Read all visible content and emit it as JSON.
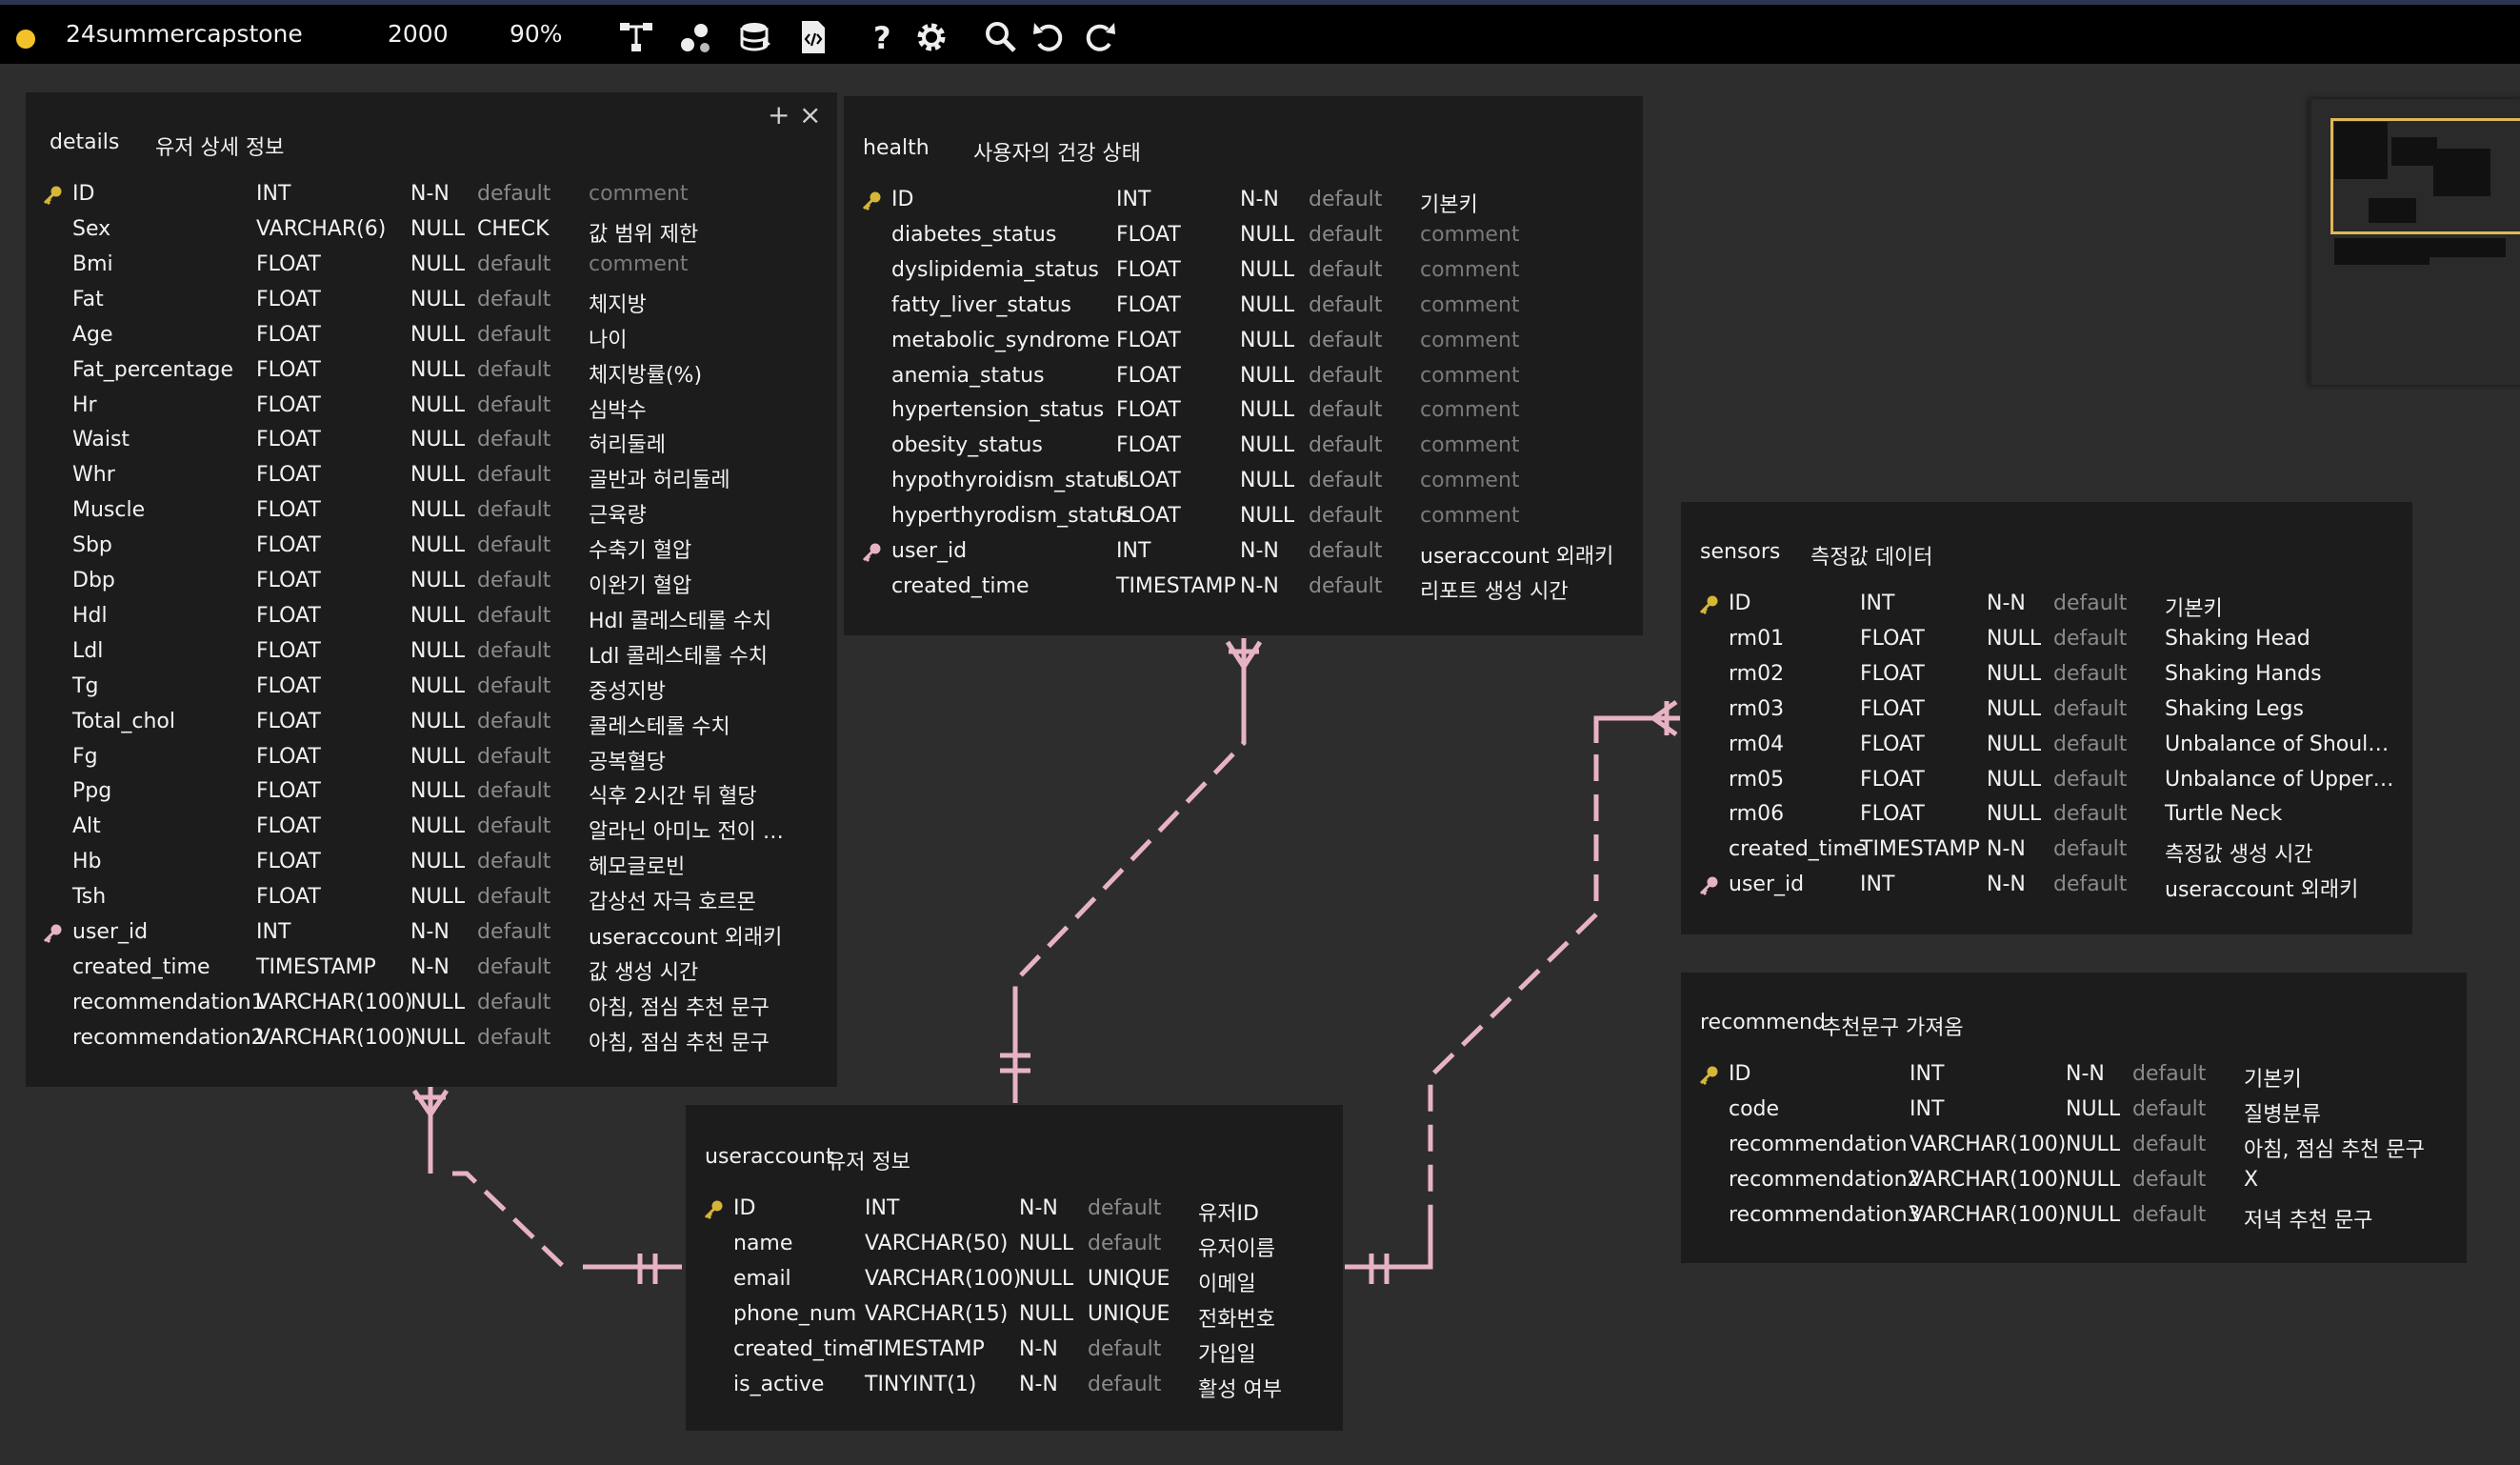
{
  "toolbar": {
    "project_name": "24summercapstone",
    "canvas_size": "2000",
    "zoom": "90%",
    "icons": [
      "diagram-icon",
      "relation-icon",
      "database-icon",
      "code-file-icon",
      "help-icon",
      "settings-icon",
      "search-icon",
      "undo-icon",
      "redo-icon"
    ]
  },
  "colors": {
    "background": "#2d2d2d",
    "table_background": "#1c1c1c",
    "relation_line": "#e7b3c3",
    "key": "#d6b637",
    "minimap_viewport": "#e0b85a",
    "status_dot": "#f3c12a"
  },
  "tables": {
    "details": {
      "name": "details",
      "comment": "유저 상세 정보",
      "header": {
        "name": "ID",
        "type": "INT",
        "nn": "N-N",
        "def": "default",
        "comment": "comment"
      },
      "columns": [
        {
          "name": "Sex",
          "type": "VARCHAR(6)",
          "nn": "NULL",
          "def": "CHECK",
          "comment": "값 범위 제한"
        },
        {
          "name": "Bmi",
          "type": "FLOAT",
          "nn": "NULL",
          "def": "default",
          "comment": "comment"
        },
        {
          "name": "Fat",
          "type": "FLOAT",
          "nn": "NULL",
          "def": "default",
          "comment": "체지방"
        },
        {
          "name": "Age",
          "type": "FLOAT",
          "nn": "NULL",
          "def": "default",
          "comment": "나이"
        },
        {
          "name": "Fat_percentage",
          "type": "FLOAT",
          "nn": "NULL",
          "def": "default",
          "comment": "체지방률(%)"
        },
        {
          "name": "Hr",
          "type": "FLOAT",
          "nn": "NULL",
          "def": "default",
          "comment": "심박수"
        },
        {
          "name": "Waist",
          "type": "FLOAT",
          "nn": "NULL",
          "def": "default",
          "comment": "허리둘레"
        },
        {
          "name": "Whr",
          "type": "FLOAT",
          "nn": "NULL",
          "def": "default",
          "comment": "골반과 허리둘레"
        },
        {
          "name": "Muscle",
          "type": "FLOAT",
          "nn": "NULL",
          "def": "default",
          "comment": "근육량"
        },
        {
          "name": "Sbp",
          "type": "FLOAT",
          "nn": "NULL",
          "def": "default",
          "comment": "수축기 혈압"
        },
        {
          "name": "Dbp",
          "type": "FLOAT",
          "nn": "NULL",
          "def": "default",
          "comment": "이완기 혈압"
        },
        {
          "name": "Hdl",
          "type": "FLOAT",
          "nn": "NULL",
          "def": "default",
          "comment": "Hdl 콜레스테롤 수치"
        },
        {
          "name": "Ldl",
          "type": "FLOAT",
          "nn": "NULL",
          "def": "default",
          "comment": "Ldl 콜레스테롤 수치"
        },
        {
          "name": "Tg",
          "type": "FLOAT",
          "nn": "NULL",
          "def": "default",
          "comment": "중성지방"
        },
        {
          "name": "Total_chol",
          "type": "FLOAT",
          "nn": "NULL",
          "def": "default",
          "comment": "콜레스테롤 수치"
        },
        {
          "name": "Fg",
          "type": "FLOAT",
          "nn": "NULL",
          "def": "default",
          "comment": "공복혈당"
        },
        {
          "name": "Ppg",
          "type": "FLOAT",
          "nn": "NULL",
          "def": "default",
          "comment": "식후 2시간 뒤 혈당"
        },
        {
          "name": "Alt",
          "type": "FLOAT",
          "nn": "NULL",
          "def": "default",
          "comment": "알라닌 아미노 전이 …"
        },
        {
          "name": "Hb",
          "type": "FLOAT",
          "nn": "NULL",
          "def": "default",
          "comment": "헤모글로빈"
        },
        {
          "name": "Tsh",
          "type": "FLOAT",
          "nn": "NULL",
          "def": "default",
          "comment": "갑상선 자극 호르몬"
        },
        {
          "name": "user_id",
          "type": "INT",
          "nn": "N-N",
          "def": "default",
          "comment": "useraccount 외래키"
        },
        {
          "name": "created_time",
          "type": "TIMESTAMP",
          "nn": "N-N",
          "def": "default",
          "comment": "값 생성 시간"
        },
        {
          "name": "recommendation1",
          "type": "VARCHAR(100)",
          "nn": "NULL",
          "def": "default",
          "comment": "아침, 점심 추천 문구"
        },
        {
          "name": "recommendation2",
          "type": "VARCHAR(100)",
          "nn": "NULL",
          "def": "default",
          "comment": "아침, 점심 추천 문구"
        }
      ]
    },
    "health": {
      "name": "health",
      "comment": "사용자의 건강 상태",
      "columns": [
        {
          "name": "ID",
          "type": "INT",
          "nn": "N-N",
          "def": "default",
          "comment": "기본키"
        },
        {
          "name": "diabetes_status",
          "type": "FLOAT",
          "nn": "NULL",
          "def": "default",
          "comment": "comment"
        },
        {
          "name": "dyslipidemia_status",
          "type": "FLOAT",
          "nn": "NULL",
          "def": "default",
          "comment": "comment"
        },
        {
          "name": "fatty_liver_status",
          "type": "FLOAT",
          "nn": "NULL",
          "def": "default",
          "comment": "comment"
        },
        {
          "name": "metabolic_syndrome",
          "type": "FLOAT",
          "nn": "NULL",
          "def": "default",
          "comment": "comment"
        },
        {
          "name": "anemia_status",
          "type": "FLOAT",
          "nn": "NULL",
          "def": "default",
          "comment": "comment"
        },
        {
          "name": "hypertension_status",
          "type": "FLOAT",
          "nn": "NULL",
          "def": "default",
          "comment": "comment"
        },
        {
          "name": "obesity_status",
          "type": "FLOAT",
          "nn": "NULL",
          "def": "default",
          "comment": "comment"
        },
        {
          "name": "hypothyroidism_status",
          "type": "FLOAT",
          "nn": "NULL",
          "def": "default",
          "comment": "comment"
        },
        {
          "name": "hyperthyrodism_status",
          "type": "FLOAT",
          "nn": "NULL",
          "def": "default",
          "comment": "comment"
        },
        {
          "name": "user_id",
          "type": "INT",
          "nn": "N-N",
          "def": "default",
          "comment": "useraccount 외래키"
        },
        {
          "name": "created_time",
          "type": "TIMESTAMP",
          "nn": "N-N",
          "def": "default",
          "comment": "리포트 생성 시간"
        }
      ]
    },
    "sensors": {
      "name": "sensors",
      "comment": "측정값 데이터",
      "columns": [
        {
          "name": "ID",
          "type": "INT",
          "nn": "N-N",
          "def": "default",
          "comment": "기본키"
        },
        {
          "name": "rm01",
          "type": "FLOAT",
          "nn": "NULL",
          "def": "default",
          "comment": "Shaking Head"
        },
        {
          "name": "rm02",
          "type": "FLOAT",
          "nn": "NULL",
          "def": "default",
          "comment": "Shaking Hands"
        },
        {
          "name": "rm03",
          "type": "FLOAT",
          "nn": "NULL",
          "def": "default",
          "comment": "Shaking Legs"
        },
        {
          "name": "rm04",
          "type": "FLOAT",
          "nn": "NULL",
          "def": "default",
          "comment": "Unbalance of Shoul…"
        },
        {
          "name": "rm05",
          "type": "FLOAT",
          "nn": "NULL",
          "def": "default",
          "comment": "Unbalance of Upper…"
        },
        {
          "name": "rm06",
          "type": "FLOAT",
          "nn": "NULL",
          "def": "default",
          "comment": "Turtle Neck"
        },
        {
          "name": "created_time",
          "type": "TIMESTAMP",
          "nn": "N-N",
          "def": "default",
          "comment": "측정값 생성 시간"
        },
        {
          "name": "user_id",
          "type": "INT",
          "nn": "N-N",
          "def": "default",
          "comment": "useraccount 외래키"
        }
      ]
    },
    "recommend": {
      "name": "recommend",
      "comment": "추천문구 가져옴",
      "columns": [
        {
          "name": "ID",
          "type": "INT",
          "nn": "N-N",
          "def": "default",
          "comment": "기본키"
        },
        {
          "name": "code",
          "type": "INT",
          "nn": "NULL",
          "def": "default",
          "comment": "질병분류"
        },
        {
          "name": "recommendation",
          "type": "VARCHAR(100)",
          "nn": "NULL",
          "def": "default",
          "comment": "아침, 점심 추천 문구"
        },
        {
          "name": "recommendation2",
          "type": "VARCHAR(100)",
          "nn": "NULL",
          "def": "default",
          "comment": "X"
        },
        {
          "name": "recommendation3",
          "type": "VARCHAR(100)",
          "nn": "NULL",
          "def": "default",
          "comment": "저녁 추천 문구"
        }
      ]
    },
    "useraccount": {
      "name": "useraccount",
      "comment": "유저 정보",
      "columns": [
        {
          "name": "ID",
          "type": "INT",
          "nn": "N-N",
          "def": "default",
          "comment": "유저ID"
        },
        {
          "name": "name",
          "type": "VARCHAR(50)",
          "nn": "NULL",
          "def": "default",
          "comment": "유저이름"
        },
        {
          "name": "email",
          "type": "VARCHAR(100)",
          "nn": "NULL",
          "def": "UNIQUE",
          "comment": "이메일"
        },
        {
          "name": "phone_num",
          "type": "VARCHAR(15)",
          "nn": "NULL",
          "def": "UNIQUE",
          "comment": "전화번호"
        },
        {
          "name": "created_time",
          "type": "TIMESTAMP",
          "nn": "N-N",
          "def": "default",
          "comment": "가입일"
        },
        {
          "name": "is_active",
          "type": "TINYINT(1)",
          "nn": "N-N",
          "def": "default",
          "comment": "활성 여부"
        }
      ]
    }
  }
}
